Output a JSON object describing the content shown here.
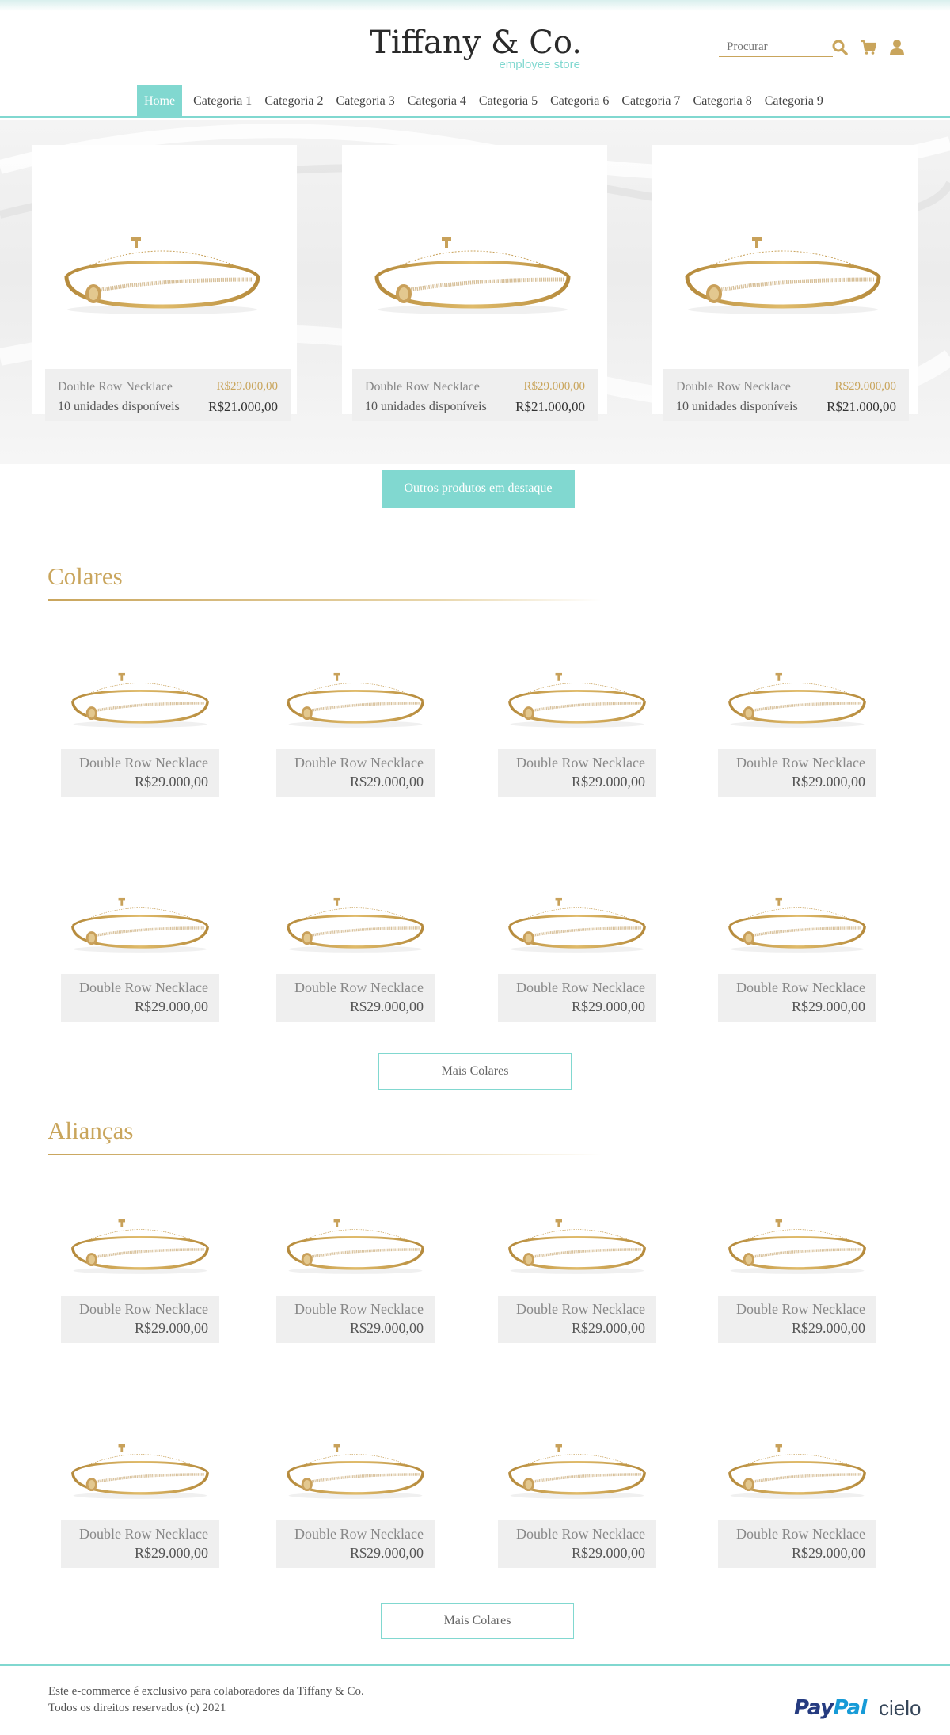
{
  "brand": {
    "name": "Tiffany & Co.",
    "subtitle": "employee store"
  },
  "header": {
    "search_placeholder": "Procurar",
    "icons": [
      "search-icon",
      "cart-icon",
      "user-icon"
    ]
  },
  "nav": {
    "items": [
      "Home",
      "Categoria 1",
      "Categoria 2",
      "Categoria 3",
      "Categoria 4",
      "Categoria 5",
      "Categoria 6",
      "Categoria 7",
      "Categoria 8",
      "Categoria 9"
    ],
    "active": "Home"
  },
  "featured": {
    "items": [
      {
        "name": "Double Row Necklace",
        "old_price": "R$29.000,00",
        "stock": "10 unidades disponíveis",
        "price": "R$21.000,00"
      },
      {
        "name": "Double Row Necklace",
        "old_price": "R$29.000,00",
        "stock": "10 unidades disponíveis",
        "price": "R$21.000,00"
      },
      {
        "name": "Double Row Necklace",
        "old_price": "R$29.000,00",
        "stock": "10 unidades disponíveis",
        "price": "R$21.000,00"
      }
    ],
    "button": "Outros produtos em destaque"
  },
  "sections": [
    {
      "title": "Colares",
      "products": [
        {
          "name": "Double Row Necklace",
          "price": "R$29.000,00"
        },
        {
          "name": "Double Row Necklace",
          "price": "R$29.000,00"
        },
        {
          "name": "Double Row Necklace",
          "price": "R$29.000,00"
        },
        {
          "name": "Double Row Necklace",
          "price": "R$29.000,00"
        },
        {
          "name": "Double Row Necklace",
          "price": "R$29.000,00"
        },
        {
          "name": "Double Row Necklace",
          "price": "R$29.000,00"
        },
        {
          "name": "Double Row Necklace",
          "price": "R$29.000,00"
        },
        {
          "name": "Double Row Necklace",
          "price": "R$29.000,00"
        }
      ],
      "more_button": "Mais Colares"
    },
    {
      "title": "Alianças",
      "products": [
        {
          "name": "Double Row Necklace",
          "price": "R$29.000,00"
        },
        {
          "name": "Double Row Necklace",
          "price": "R$29.000,00"
        },
        {
          "name": "Double Row Necklace",
          "price": "R$29.000,00"
        },
        {
          "name": "Double Row Necklace",
          "price": "R$29.000,00"
        },
        {
          "name": "Double Row Necklace",
          "price": "R$29.000,00"
        },
        {
          "name": "Double Row Necklace",
          "price": "R$29.000,00"
        },
        {
          "name": "Double Row Necklace",
          "price": "R$29.000,00"
        },
        {
          "name": "Double Row Necklace",
          "price": "R$29.000,00"
        }
      ],
      "more_button": "Mais Colares"
    }
  ],
  "footer": {
    "line1": "Este e-commerce é exclusivo para colaboradores da Tiffany & Co.",
    "line2": "Todos os direitos reservados (c) 2021",
    "payment_logos": {
      "paypal_a": "Pay",
      "paypal_b": "Pal",
      "cielo": "cielo"
    }
  },
  "colors": {
    "tiffany_blue": "#81d8d0",
    "gold": "#c9a55c"
  }
}
